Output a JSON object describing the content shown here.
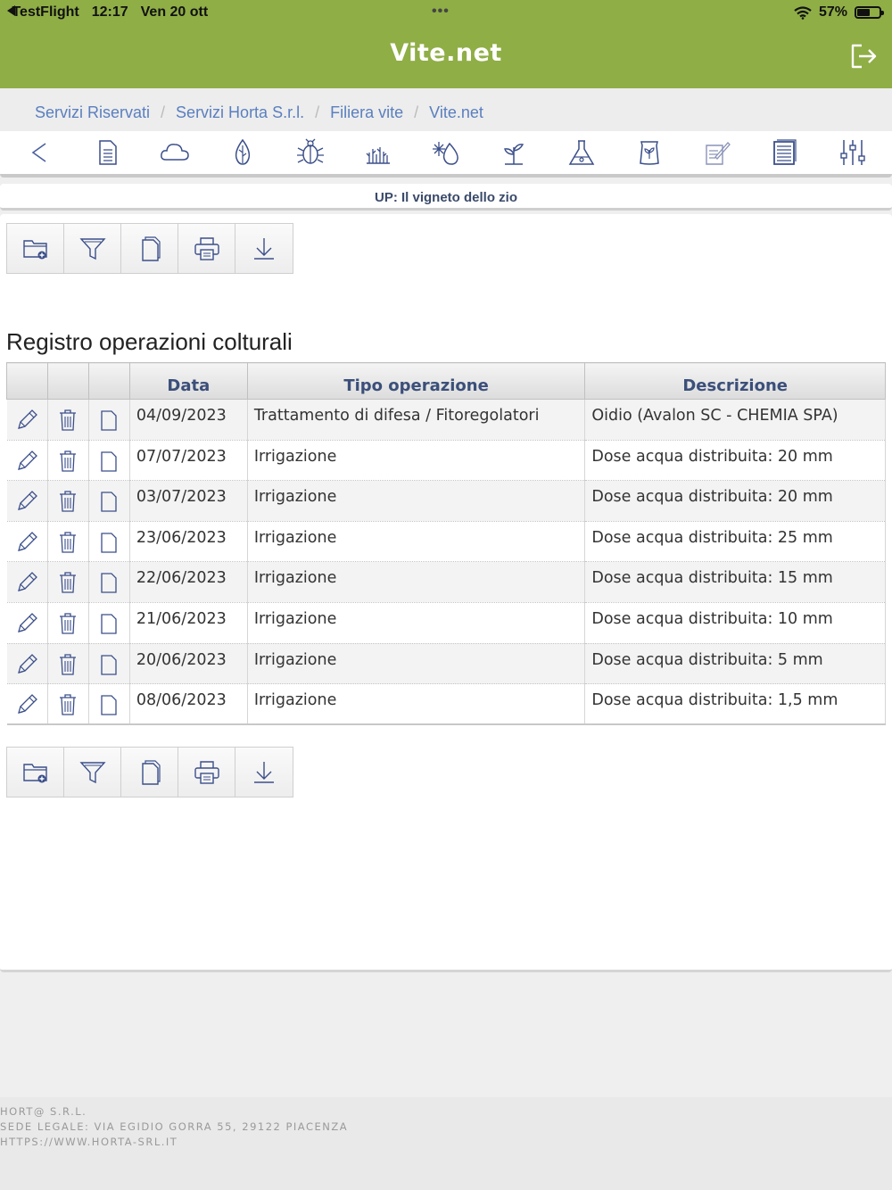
{
  "status_bar": {
    "back_app": "TestFlight",
    "time": "12:17",
    "date": "Ven 20 ott",
    "dots": "•••",
    "battery": "57%"
  },
  "header": {
    "title": "Vite.net"
  },
  "breadcrumb": [
    "Servizi Riservati",
    "Servizi Horta S.r.l.",
    "Filiera vite",
    "Vite.net"
  ],
  "breadcrumb_separator": "/",
  "up_label": "UP: Il vigneto dello zio",
  "page_title": "Registro operazioni colturali",
  "table": {
    "headers": [
      "Data",
      "Tipo operazione",
      "Descrizione"
    ],
    "rows": [
      {
        "data": "04/09/2023",
        "tipo": "Trattamento di difesa / Fitoregolatori",
        "descrizione": "Oidio (Avalon SC - CHEMIA SPA)"
      },
      {
        "data": "07/07/2023",
        "tipo": "Irrigazione",
        "descrizione": "Dose acqua distribuita: 20 mm"
      },
      {
        "data": "03/07/2023",
        "tipo": "Irrigazione",
        "descrizione": "Dose acqua distribuita: 20 mm"
      },
      {
        "data": "23/06/2023",
        "tipo": "Irrigazione",
        "descrizione": "Dose acqua distribuita: 25 mm"
      },
      {
        "data": "22/06/2023",
        "tipo": "Irrigazione",
        "descrizione": "Dose acqua distribuita: 15 mm"
      },
      {
        "data": "21/06/2023",
        "tipo": "Irrigazione",
        "descrizione": "Dose acqua distribuita: 10 mm"
      },
      {
        "data": "20/06/2023",
        "tipo": "Irrigazione",
        "descrizione": "Dose acqua distribuita: 5 mm"
      },
      {
        "data": "08/06/2023",
        "tipo": "Irrigazione",
        "descrizione": "Dose acqua distribuita: 1,5 mm"
      }
    ]
  },
  "footer": {
    "line1": "HORT@ S.R.L.",
    "line2": "SEDE LEGALE: VIA EGIDIO GORRA 55, 29122 PIACENZA",
    "line3": "HTTPS://WWW.HORTA-SRL.IT"
  },
  "colors": {
    "header_green": "#8fae46",
    "icon_blue": "#3b4f8a",
    "link_blue": "#5a7fbf"
  }
}
